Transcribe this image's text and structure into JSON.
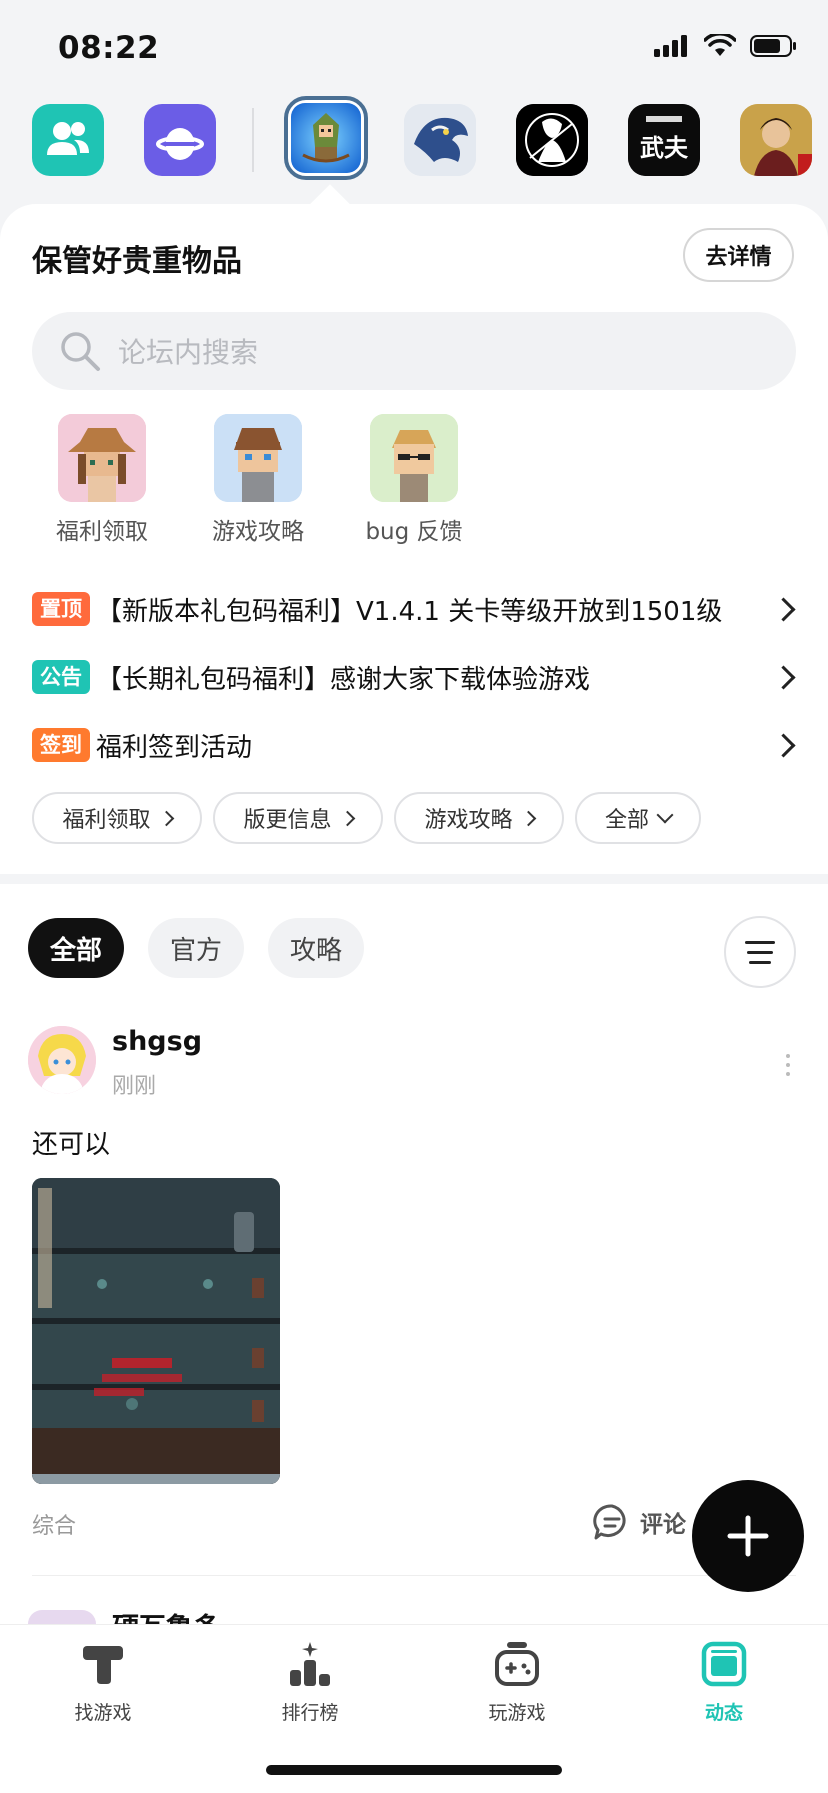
{
  "status_bar": {
    "time": "08:22"
  },
  "forum": {
    "title": "保管好贵重物品",
    "detail_button": "去详情",
    "search_placeholder": "论坛内搜索"
  },
  "quick_links": [
    {
      "label": "福利领取"
    },
    {
      "label": "游戏攻略"
    },
    {
      "label": "bug 反馈"
    }
  ],
  "notices": [
    {
      "tag": "置顶",
      "tag_color": "#ff6a3c",
      "text": "【新版本礼包码福利】V1.4.1 关卡等级开放到1501级"
    },
    {
      "tag": "公告",
      "tag_color": "#1fc4b4",
      "text": "【长期礼包码福利】感谢大家下载体验游戏"
    },
    {
      "tag": "签到",
      "tag_color": "#ff7a2e",
      "text": "福利签到活动"
    }
  ],
  "category_pills": [
    "福利领取",
    "版更信息",
    "游戏攻略",
    "全部"
  ],
  "feed_tabs": [
    "全部",
    "官方",
    "攻略"
  ],
  "post": {
    "username": "shgsg",
    "time": "刚刚",
    "text": "还可以",
    "category": "综合",
    "comment_label": "评论"
  },
  "next_post": {
    "username": "硬瓦鲁多"
  },
  "bottom_nav": [
    {
      "label": "找游戏",
      "icon": "hammer-icon"
    },
    {
      "label": "排行榜",
      "icon": "ranking-icon"
    },
    {
      "label": "玩游戏",
      "icon": "gamepad-icon"
    },
    {
      "label": "动态",
      "icon": "feed-icon"
    }
  ],
  "colors": {
    "accent": "#1fc4b4",
    "fab": "#0a0a0a"
  }
}
